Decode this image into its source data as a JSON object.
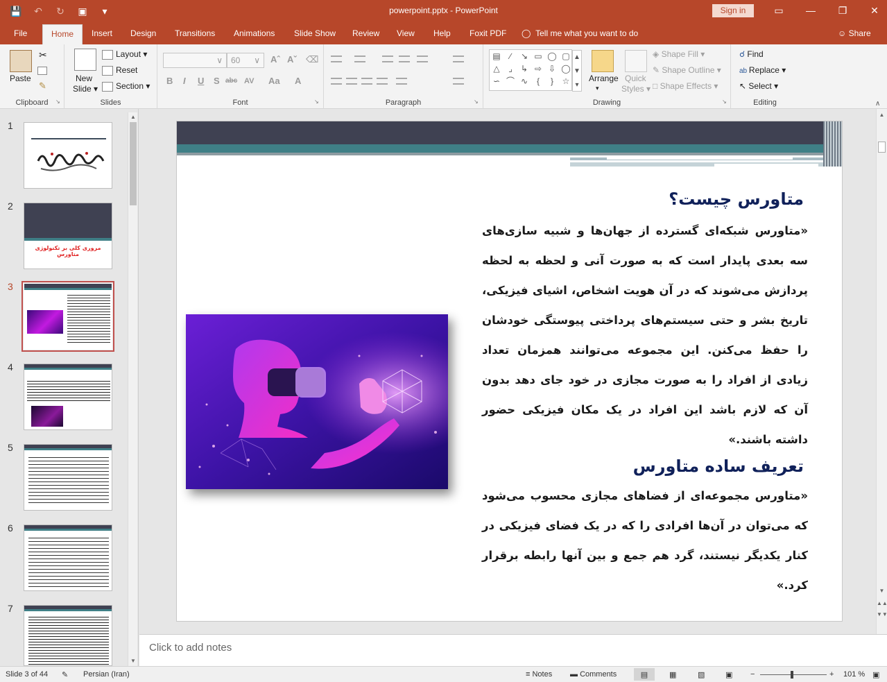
{
  "app": {
    "document_title": "powerpoint.pptx  -  PowerPoint",
    "signin_label": "Sign in",
    "window_buttons": [
      "▭",
      "—",
      "❐",
      "✕"
    ]
  },
  "tabs": [
    {
      "label": "File"
    },
    {
      "label": "Home"
    },
    {
      "label": "Insert"
    },
    {
      "label": "Design"
    },
    {
      "label": "Transitions"
    },
    {
      "label": "Animations"
    },
    {
      "label": "Slide Show"
    },
    {
      "label": "Review"
    },
    {
      "label": "View"
    },
    {
      "label": "Help"
    },
    {
      "label": "Foxit PDF"
    }
  ],
  "tell_me": "Tell me what you want to do",
  "share": "Share",
  "ribbon": {
    "clipboard": {
      "label": "Clipboard",
      "paste": "Paste"
    },
    "slides": {
      "label": "Slides",
      "new_slide_1": "New",
      "new_slide_2": "Slide",
      "layout": "Layout",
      "reset": "Reset",
      "section": "Section"
    },
    "font": {
      "label": "Font",
      "size_value": "60",
      "bold": "B",
      "italic": "I",
      "underline": "U",
      "shadow": "S",
      "strike": "abc",
      "spacing": "AV",
      "case": "Aa",
      "color": "A"
    },
    "paragraph": {
      "label": "Paragraph"
    },
    "drawing": {
      "label": "Drawing",
      "arrange": "Arrange",
      "quick_styles_1": "Quick",
      "quick_styles_2": "Styles",
      "shape_fill": "Shape Fill",
      "shape_outline": "Shape Outline",
      "shape_effects": "Shape Effects"
    },
    "editing": {
      "label": "Editing",
      "find": "Find",
      "replace": "Replace",
      "select": "Select"
    }
  },
  "thumbnails": [
    {
      "number": "1"
    },
    {
      "number": "2",
      "caption": "مروری کلی بر تکنولوژی متاورس"
    },
    {
      "number": "3"
    },
    {
      "number": "4"
    },
    {
      "number": "5"
    },
    {
      "number": "6"
    },
    {
      "number": "7"
    }
  ],
  "slide": {
    "heading1": "متاورس چیست؟",
    "paragraph1": "«متاورس  شبکه‌ای گسترده از جهان‌ها و شبیه سازی‌های سه بعدی پایدار است که به صورت آنی و لحظه به لحظه پردازش می‌شوند که در آن هویت اشخاص، اشیای فیزیکی، تاریخ بشر و حتی سیستم‌های پرداختی پیوستگی خودشان را حفظ می‌کنن. این مجموعه می‌توانند همزمان تعداد زیادی از افراد را به صورت مجازی در خود جای دهد بدون آن که لازم باشد این افراد در یک مکان فیزیکی حضور داشته باشند.»",
    "heading2": "تعریف ساده متاورس",
    "paragraph2": "«متاورس مجموعه‌ای از فضاهای مجازی محسوب می‌شود که می‌توان در آن‌ها  افرادی را که در یک فضای فیزیکی در کنار یکدیگر نیستند، گرد هم جمع  و بین آنها رابطه برقرار کرد.»"
  },
  "notes_placeholder": "Click to add notes",
  "status": {
    "slide_counter": "Slide 3 of 44",
    "language": "Persian (Iran)",
    "notes": "Notes",
    "comments": "Comments",
    "zoom": "101 %"
  }
}
